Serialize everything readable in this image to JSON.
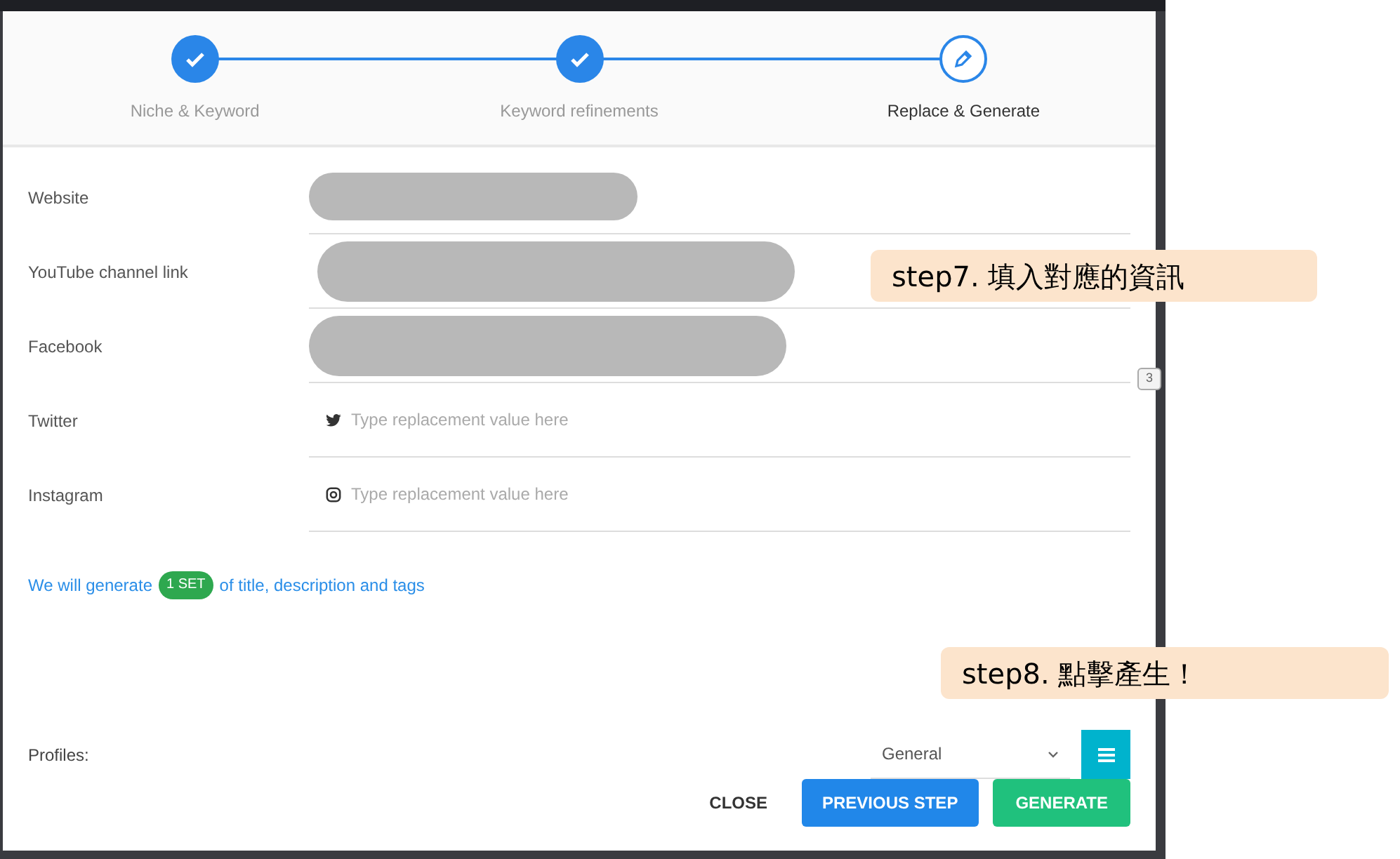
{
  "stepper": [
    {
      "label": "Niche & Keyword",
      "completed": true
    },
    {
      "label": "Keyword refinements",
      "completed": true
    },
    {
      "label": "Replace & Generate",
      "completed": false
    }
  ],
  "fields": [
    {
      "label": "Website",
      "kind": "redacted"
    },
    {
      "label": "YouTube channel link",
      "kind": "redacted"
    },
    {
      "label": "Facebook",
      "kind": "redacted"
    },
    {
      "label": "Twitter",
      "kind": "input",
      "placeholder": "Type replacement value here"
    },
    {
      "label": "Instagram",
      "kind": "input",
      "placeholder": "Type replacement value here"
    }
  ],
  "generate_note": {
    "before": "We will generate",
    "badge": "1 SET",
    "after": "of title, description and tags"
  },
  "profiles": {
    "label": "Profiles:",
    "value": "General"
  },
  "buttons": [
    {
      "label": "CLOSE",
      "kind": "plain"
    },
    {
      "label": "PREVIOUS STEP",
      "kind": "primary"
    },
    {
      "label": "GENERATE",
      "kind": "success"
    }
  ],
  "background": {
    "badge": "3"
  },
  "callouts": [
    {
      "text": "step7. 填入對應的資訊"
    },
    {
      "text": "step8. 點擊產生！"
    }
  ]
}
